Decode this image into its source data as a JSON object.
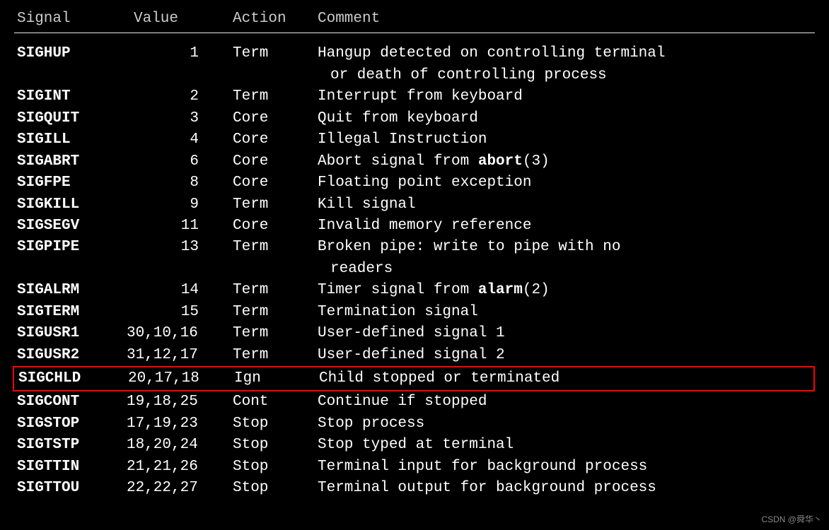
{
  "headers": {
    "signal": "Signal",
    "value": "Value",
    "action": "Action",
    "comment": "Comment"
  },
  "rows": [
    {
      "signal": "SIGHUP",
      "value": "1",
      "action": "Term",
      "comment": "Hangup detected on controlling terminal",
      "continuation": "or death of controlling process",
      "rightAlign": true
    },
    {
      "signal": "SIGINT",
      "value": "2",
      "action": "Term",
      "comment": "Interrupt from keyboard",
      "rightAlign": true
    },
    {
      "signal": "SIGQUIT",
      "value": "3",
      "action": "Core",
      "comment": "Quit from keyboard",
      "rightAlign": true
    },
    {
      "signal": "SIGILL",
      "value": "4",
      "action": "Core",
      "comment": "Illegal Instruction",
      "rightAlign": true
    },
    {
      "signal": "SIGABRT",
      "value": "6",
      "action": "Core",
      "comment_prefix": "Abort signal from ",
      "comment_bold": "abort",
      "comment_suffix": "(3)",
      "rightAlign": true
    },
    {
      "signal": "SIGFPE",
      "value": "8",
      "action": "Core",
      "comment": "Floating point exception",
      "rightAlign": true
    },
    {
      "signal": "SIGKILL",
      "value": "9",
      "action": "Term",
      "comment": "Kill signal",
      "rightAlign": true
    },
    {
      "signal": "SIGSEGV",
      "value": "11",
      "action": "Core",
      "comment": "Invalid memory reference",
      "rightAlign": true
    },
    {
      "signal": "SIGPIPE",
      "value": "13",
      "action": "Term",
      "comment": "Broken pipe: write to pipe with no",
      "continuation": "readers",
      "rightAlign": true
    },
    {
      "signal": "SIGALRM",
      "value": "14",
      "action": "Term",
      "comment_prefix": "Timer signal from ",
      "comment_bold": "alarm",
      "comment_suffix": "(2)",
      "rightAlign": true
    },
    {
      "signal": "SIGTERM",
      "value": "15",
      "action": "Term",
      "comment": "Termination signal",
      "rightAlign": true
    },
    {
      "signal": "SIGUSR1",
      "value": "30,10,16",
      "action": "Term",
      "comment": "User-defined signal 1"
    },
    {
      "signal": "SIGUSR2",
      "value": "31,12,17",
      "action": "Term",
      "comment": "User-defined signal 2"
    },
    {
      "signal": "SIGCHLD",
      "value": "20,17,18",
      "action": "Ign",
      "comment": "Child stopped or terminated",
      "highlighted": true
    },
    {
      "signal": "SIGCONT",
      "value": "19,18,25",
      "action": "Cont",
      "comment": "Continue if stopped"
    },
    {
      "signal": "SIGSTOP",
      "value": "17,19,23",
      "action": "Stop",
      "comment": "Stop process"
    },
    {
      "signal": "SIGTSTP",
      "value": "18,20,24",
      "action": "Stop",
      "comment": "Stop typed at terminal"
    },
    {
      "signal": "SIGTTIN",
      "value": "21,21,26",
      "action": "Stop",
      "comment": "Terminal input for background process"
    },
    {
      "signal": "SIGTTOU",
      "value": "22,22,27",
      "action": "Stop",
      "comment": "Terminal output for background process"
    }
  ],
  "watermark": "CSDN @舜华丶"
}
